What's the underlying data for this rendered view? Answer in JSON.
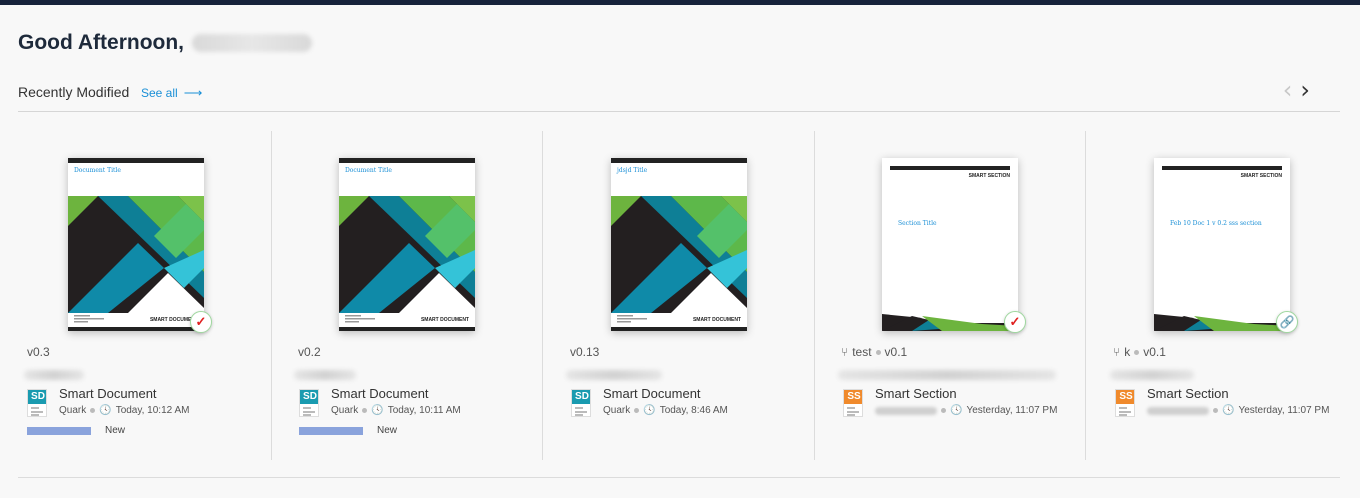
{
  "header": {
    "greeting": "Good Afternoon,"
  },
  "section": {
    "title": "Recently Modified",
    "see_all": "See all",
    "see_all_icon": "arrow-right-icon",
    "prev_icon": "chevron-left-icon",
    "next_icon": "chevron-right-icon"
  },
  "colors": {
    "accent": "#1a8fd6",
    "topbar": "#17233b",
    "doc_icon": "#1a9bb0",
    "section_icon": "#f08a2c",
    "tag_new": "#8aa3dc"
  },
  "cards": [
    {
      "kind": "document",
      "thumb_title": "Document Title",
      "footer_label": "SMART DOCUMENT",
      "version": "v0.3",
      "branch": "",
      "type_abbr": "SD",
      "type_name": "Smart Document",
      "owner": "Quark",
      "time": "Today, 10:12 AM",
      "badge": "check-icon",
      "tag": "New"
    },
    {
      "kind": "document",
      "thumb_title": "Document Title",
      "footer_label": "SMART DOCUMENT",
      "version": "v0.2",
      "branch": "",
      "type_abbr": "SD",
      "type_name": "Smart Document",
      "owner": "Quark",
      "time": "Today, 10:11 AM",
      "badge": "",
      "tag": "New"
    },
    {
      "kind": "document",
      "thumb_title": "jdsjd Title",
      "footer_label": "SMART DOCUMENT",
      "version": "v0.13",
      "branch": "",
      "type_abbr": "SD",
      "type_name": "Smart Document",
      "owner": "Quark",
      "time": "Today, 8:46 AM",
      "badge": "",
      "tag": ""
    },
    {
      "kind": "section",
      "thumb_title": "Section Title",
      "header_label": "SMART SECTION",
      "version": "v0.1",
      "branch": "test",
      "type_abbr": "SS",
      "type_name": "Smart Section",
      "owner": "",
      "time": "Yesterday, 11:07 PM",
      "badge": "check-icon",
      "tag": ""
    },
    {
      "kind": "section",
      "thumb_title": "Feb 10 Doc 1 v 0.2 sss section",
      "header_label": "SMART SECTION",
      "version": "v0.1",
      "branch": "k",
      "type_abbr": "SS",
      "type_name": "Smart Section",
      "owner": "",
      "time": "Yesterday, 11:07 PM",
      "badge": "link-icon",
      "tag": ""
    }
  ]
}
